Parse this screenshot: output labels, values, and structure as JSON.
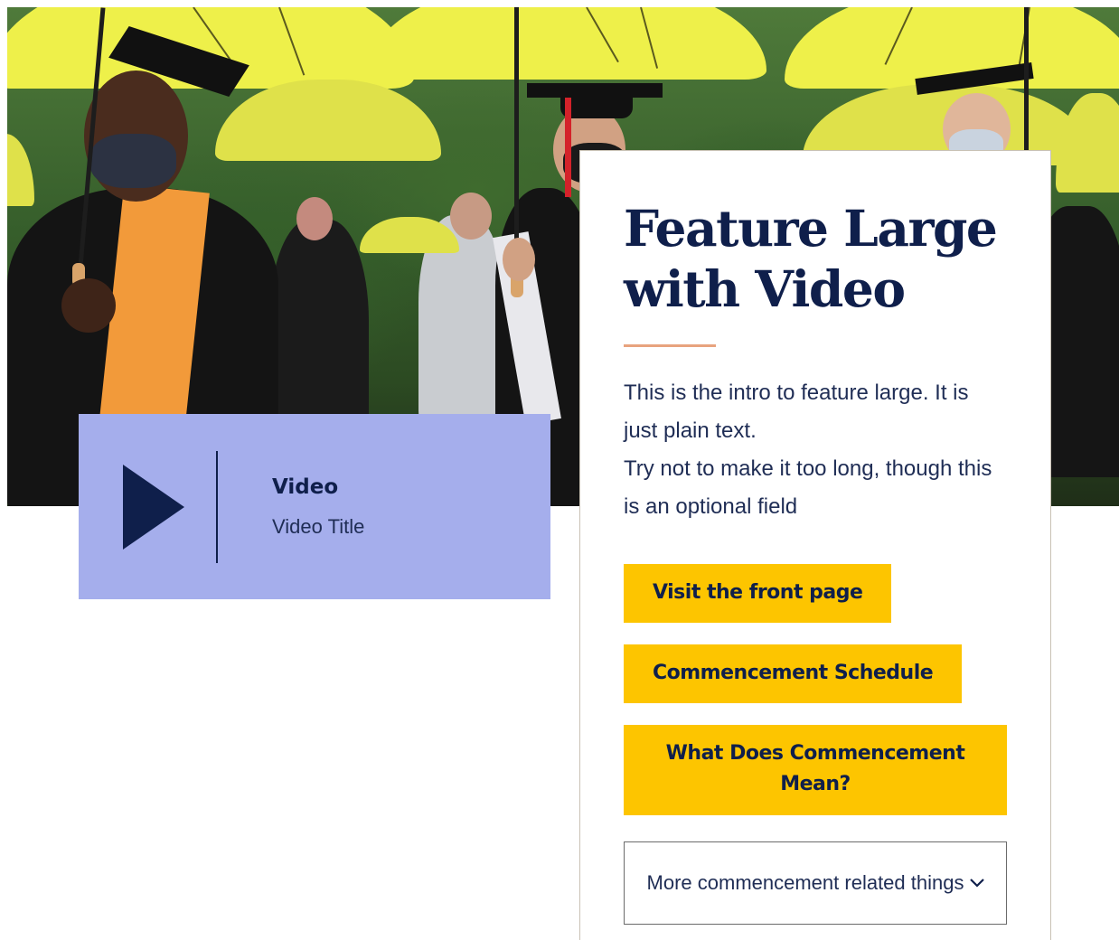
{
  "hero": {
    "image": "graduates-with-yellow-umbrellas"
  },
  "video": {
    "play_icon": "play-icon",
    "label": "Video",
    "title": "Video Title"
  },
  "feature": {
    "title": "Feature Large with Video",
    "intro_line_1": "This is the intro to feature large. It is just plain text.",
    "intro_line_2": "Try not to make it too long, though this is an optional field",
    "buttons": [
      {
        "label": "Visit the front page"
      },
      {
        "label": "Commencement Schedule"
      },
      {
        "label": "What Does Commencement Mean?"
      }
    ],
    "dropdown": {
      "label": "More commencement related things",
      "icon": "chevron-down-icon"
    }
  },
  "colors": {
    "navy": "#0f1f4b",
    "video_bg": "#a5aeec",
    "button_gold": "#fdc500",
    "accent_rule": "#e8a37e"
  }
}
